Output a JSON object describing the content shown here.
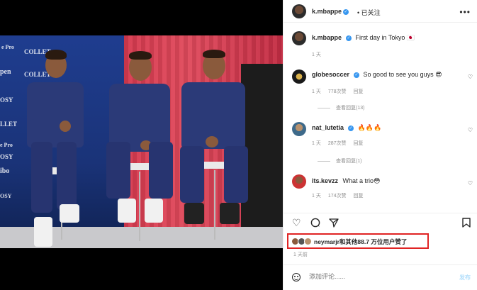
{
  "header": {
    "username": "k.mbappe",
    "verified_mark": "✓",
    "separator": "•",
    "follow_status": "已关注",
    "more_icon": "more-horizontal-icon"
  },
  "caption": {
    "username": "k.mbappe",
    "text": "First day in Tokyo 🇯🇵",
    "time": "1 天"
  },
  "photo": {
    "wall_texts": [
      "e Pro",
      "COLLET",
      "COLLET",
      "pen",
      "OSY",
      "LLET",
      "OSY",
      "e Pro",
      "ibo",
      "OSY"
    ]
  },
  "comments": [
    {
      "username": "globesoccer",
      "verified": true,
      "text": "So good to see you guys 😎",
      "time": "1 天",
      "likes": "778次赞",
      "reply": "回复",
      "view_replies": "查看回复(13)"
    },
    {
      "username": "nat_lutetia",
      "verified": true,
      "text": "🔥🔥🔥",
      "time": "1 天",
      "likes": "287次赞",
      "reply": "回复",
      "view_replies": "查看回复(1)"
    },
    {
      "username": "its.kevzz",
      "verified": false,
      "text": "What a trio😳",
      "time": "1 天",
      "likes": "174次赞",
      "reply": "回复",
      "view_replies": ""
    }
  ],
  "likes": {
    "text": "neymarjr和其他88.7 万位用户赞了"
  },
  "post_time": "1 天前",
  "comment_box": {
    "placeholder": "添加评论......",
    "post_label": "发布"
  },
  "colors": {
    "verified": "#3897f0",
    "highlight_border": "#e02424",
    "post_button": "#b2dffc"
  }
}
